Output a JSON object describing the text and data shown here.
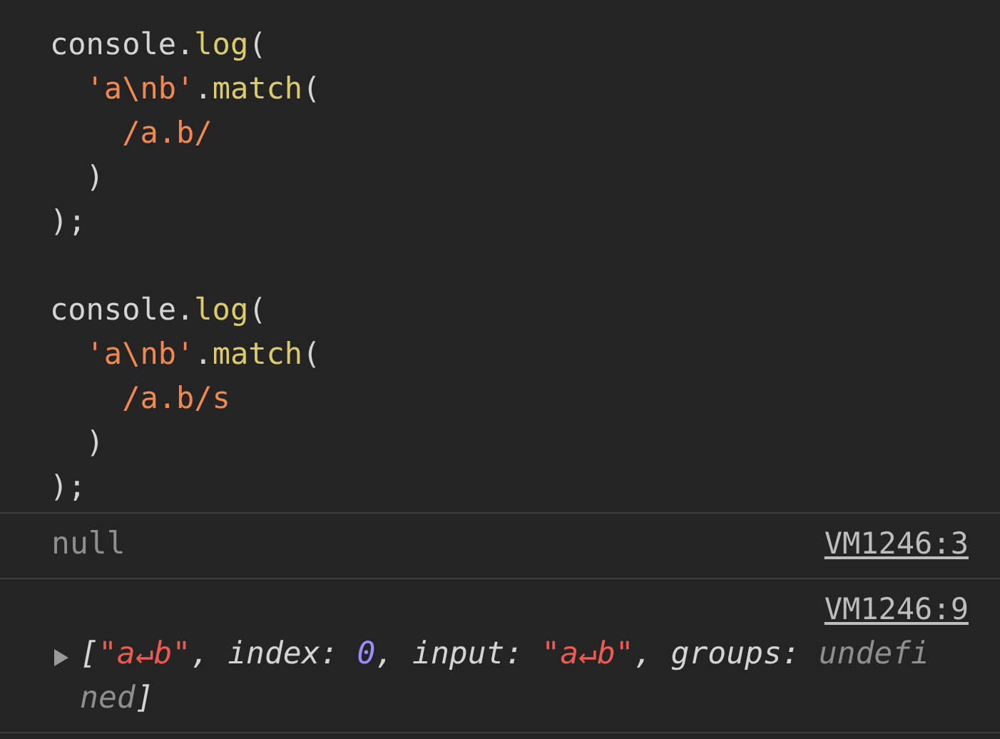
{
  "code_blocks": [
    {
      "lines": [
        [
          {
            "kind": "plain",
            "text": "console."
          },
          {
            "kind": "func",
            "text": "log"
          },
          {
            "kind": "plain",
            "text": "("
          }
        ],
        [
          {
            "kind": "string",
            "text": "  'a\\nb'"
          },
          {
            "kind": "plain",
            "text": "."
          },
          {
            "kind": "func",
            "text": "match"
          },
          {
            "kind": "plain",
            "text": "("
          }
        ],
        [
          {
            "kind": "string",
            "text": "    /a.b/"
          }
        ],
        [
          {
            "kind": "plain",
            "text": "  )"
          }
        ],
        [
          {
            "kind": "plain",
            "text": ");"
          }
        ]
      ]
    },
    {
      "lines": [
        [
          {
            "kind": "plain",
            "text": "console."
          },
          {
            "kind": "func",
            "text": "log"
          },
          {
            "kind": "plain",
            "text": "("
          }
        ],
        [
          {
            "kind": "string",
            "text": "  'a\\nb'"
          },
          {
            "kind": "plain",
            "text": "."
          },
          {
            "kind": "func",
            "text": "match"
          },
          {
            "kind": "plain",
            "text": "("
          }
        ],
        [
          {
            "kind": "string",
            "text": "    /a.b/s"
          }
        ],
        [
          {
            "kind": "plain",
            "text": "  )"
          }
        ],
        [
          {
            "kind": "plain",
            "text": ");"
          }
        ]
      ]
    }
  ],
  "console_entries": [
    {
      "kind": "plain",
      "source": "VM1246:3",
      "tokens": [
        {
          "kind": "null",
          "text": "null"
        }
      ]
    },
    {
      "kind": "expandable",
      "expanded": false,
      "source": "VM1246:9",
      "tokens": [
        {
          "kind": "punct",
          "text": "["
        },
        {
          "kind": "string",
          "text": "\"a↵b\""
        },
        {
          "kind": "punct",
          "text": ", index: "
        },
        {
          "kind": "number",
          "text": "0"
        },
        {
          "kind": "punct",
          "text": ", input: "
        },
        {
          "kind": "string",
          "text": "\"a↵b\""
        },
        {
          "kind": "punct",
          "text": ", groups: "
        },
        {
          "kind": "null",
          "text": "undefined"
        },
        {
          "kind": "punct",
          "text": "]"
        }
      ]
    }
  ]
}
